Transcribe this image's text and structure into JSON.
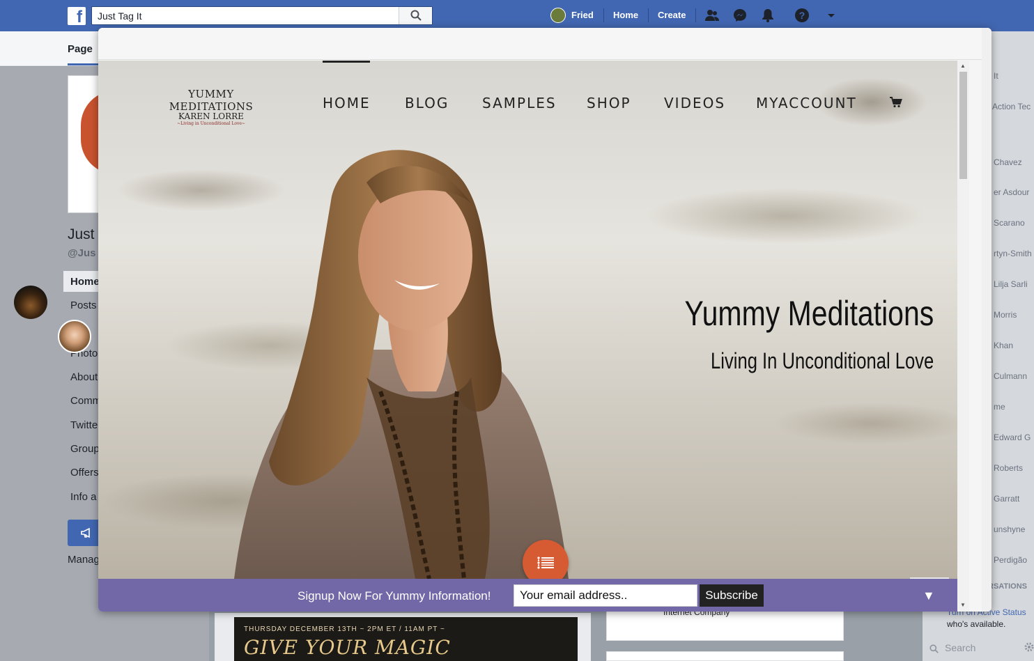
{
  "facebook": {
    "search": {
      "value": "Just Tag It"
    },
    "user_name": "Fried",
    "nav": {
      "home": "Home",
      "create": "Create"
    },
    "page_tab": "Page",
    "page_name": "Just",
    "page_handle": "@Jus",
    "menu": [
      "Home",
      "Posts",
      "Photo",
      "About",
      "Comm",
      "Twitte",
      "Group",
      "Offers",
      "Info a"
    ],
    "manage": "Manag",
    "contacts": [
      "It",
      "Action Tec",
      "Chavez",
      "er Asdour",
      "Scarano",
      "rtyn-Smith",
      "Lilja Sarli",
      "Morris",
      "Khan",
      "Culmann",
      "me",
      "Edward G",
      "Roberts",
      "Garratt",
      "unshyne",
      "Perdigão"
    ],
    "conversations": "RSATIONS",
    "active_status": "Turn on Active Status",
    "whos_available": "who's available.",
    "chat_search": "Search",
    "post_line": "THURSDAY DECEMBER 13TH ~ 2PM ET / 11AM PT ~",
    "post_title": "GIVE YOUR MAGIC",
    "right_card_text": "Internet Company"
  },
  "site": {
    "logo": {
      "main": "YUMMY MEDITATIONS",
      "sub": "KAREN LORRE",
      "tag": "~Living in Unconditional Love~"
    },
    "nav": [
      {
        "label": "HOME"
      },
      {
        "label": "BLOG"
      },
      {
        "label": "SAMPLES"
      },
      {
        "label": "SHOP"
      },
      {
        "label": "VIDEOS"
      },
      {
        "label": "MYACCOUNT"
      }
    ],
    "hero_title": "Yummy Meditations",
    "hero_subtitle": "Living In Unconditional Love",
    "signup": {
      "text": "Signup Now For Yummy Information!",
      "email_value": "Your email address..",
      "button": "Subscribe",
      "collapse": "▼"
    }
  },
  "colors": {
    "fb_blue": "#4267b2",
    "signup_purple": "#7267a7",
    "fab_orange": "#d65a32"
  }
}
